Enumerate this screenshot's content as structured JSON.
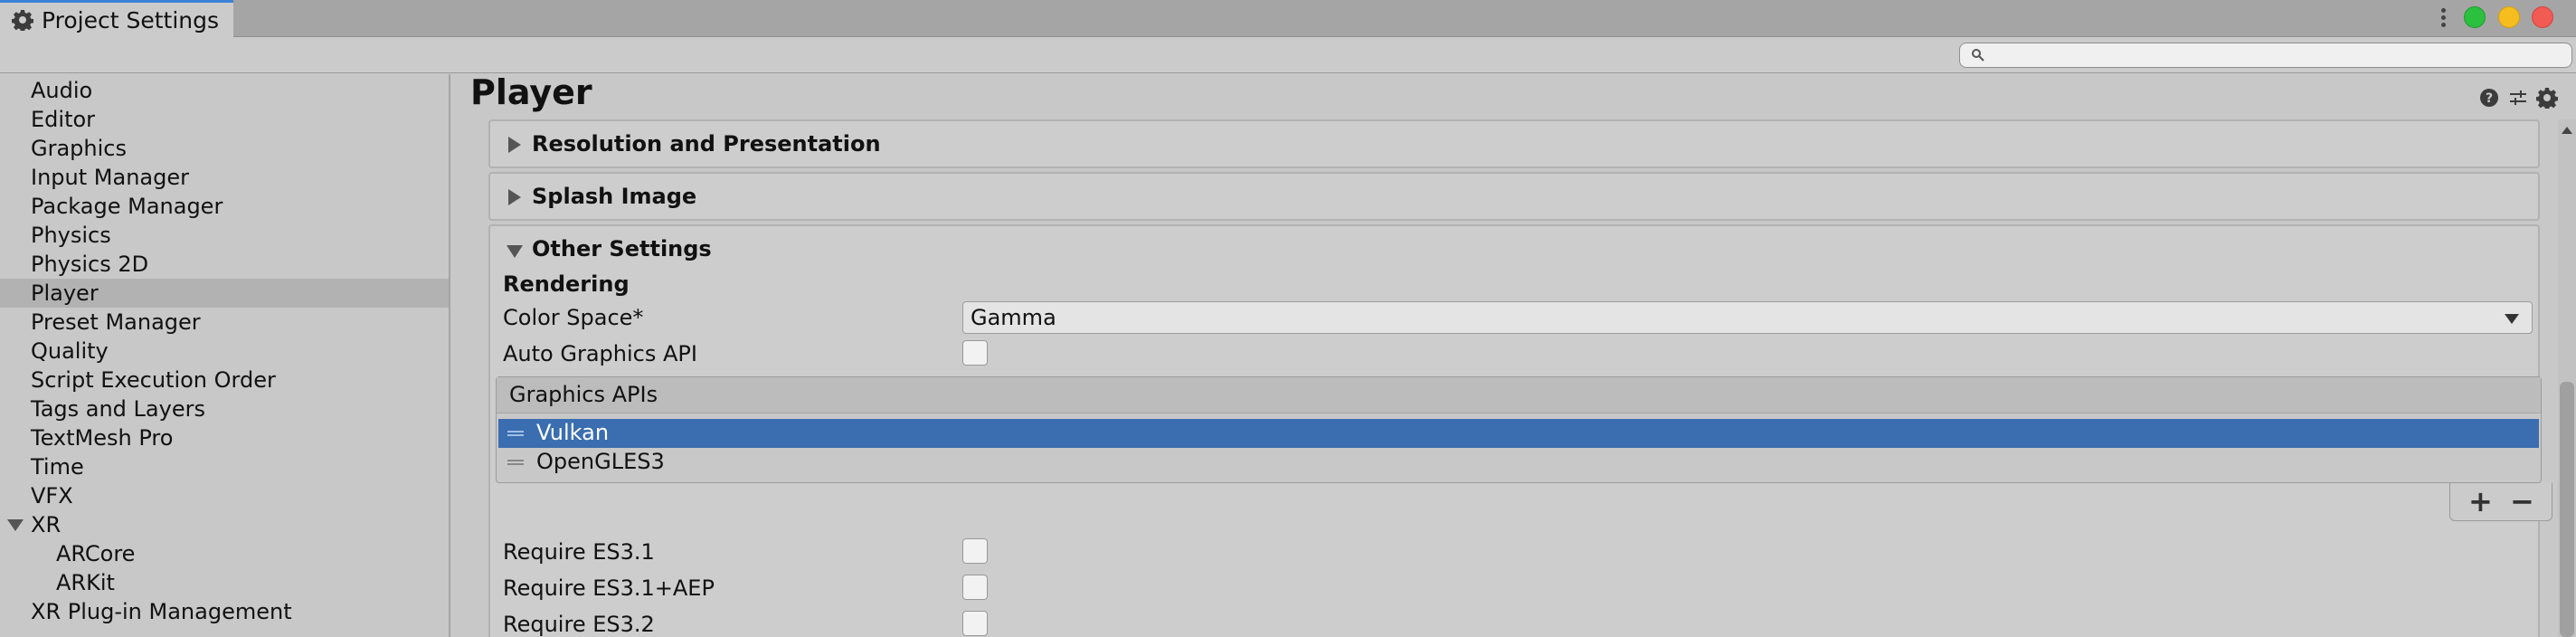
{
  "window": {
    "tab_title": "Project Settings",
    "traffic_colors": {
      "green": "#2bc13f",
      "yellow": "#f6bd1f",
      "red": "#f25a54"
    }
  },
  "search": {
    "placeholder": ""
  },
  "sidebar": {
    "items": [
      {
        "label": "Audio"
      },
      {
        "label": "Editor"
      },
      {
        "label": "Graphics"
      },
      {
        "label": "Input Manager"
      },
      {
        "label": "Package Manager"
      },
      {
        "label": "Physics"
      },
      {
        "label": "Physics 2D"
      },
      {
        "label": "Player",
        "selected": true
      },
      {
        "label": "Preset Manager"
      },
      {
        "label": "Quality"
      },
      {
        "label": "Script Execution Order"
      },
      {
        "label": "Tags and Layers"
      },
      {
        "label": "TextMesh Pro"
      },
      {
        "label": "Time"
      },
      {
        "label": "VFX"
      },
      {
        "label": "XR",
        "expanded": true
      },
      {
        "label": "ARCore",
        "indent": 1
      },
      {
        "label": "ARKit",
        "indent": 1
      },
      {
        "label": "XR Plug-in Management"
      }
    ]
  },
  "main": {
    "title": "Player",
    "header_icons": [
      "help-icon",
      "preset-icon",
      "settings-icon"
    ],
    "sections": [
      {
        "title": "Resolution and Presentation",
        "expanded": false
      },
      {
        "title": "Splash Image",
        "expanded": false
      },
      {
        "title": "Other Settings",
        "expanded": true
      }
    ],
    "rendering": {
      "heading": "Rendering",
      "color_space_label": "Color Space*",
      "color_space_value": "Gamma",
      "auto_graphics_api_label": "Auto Graphics API",
      "auto_graphics_api_checked": false,
      "graphics_apis": {
        "header": "Graphics APIs",
        "items": [
          {
            "label": "Vulkan",
            "selected": true
          },
          {
            "label": "OpenGLES3",
            "selected": false
          }
        ],
        "add_label": "+",
        "remove_label": "−"
      },
      "require_es31_label": "Require ES3.1",
      "require_es31_aep_label": "Require ES3.1+AEP",
      "require_es32_label": "Require ES3.2",
      "require_es31_checked": false,
      "require_es31_aep_checked": false,
      "require_es32_checked": false
    },
    "accent_selection": "#3a6eb0"
  }
}
